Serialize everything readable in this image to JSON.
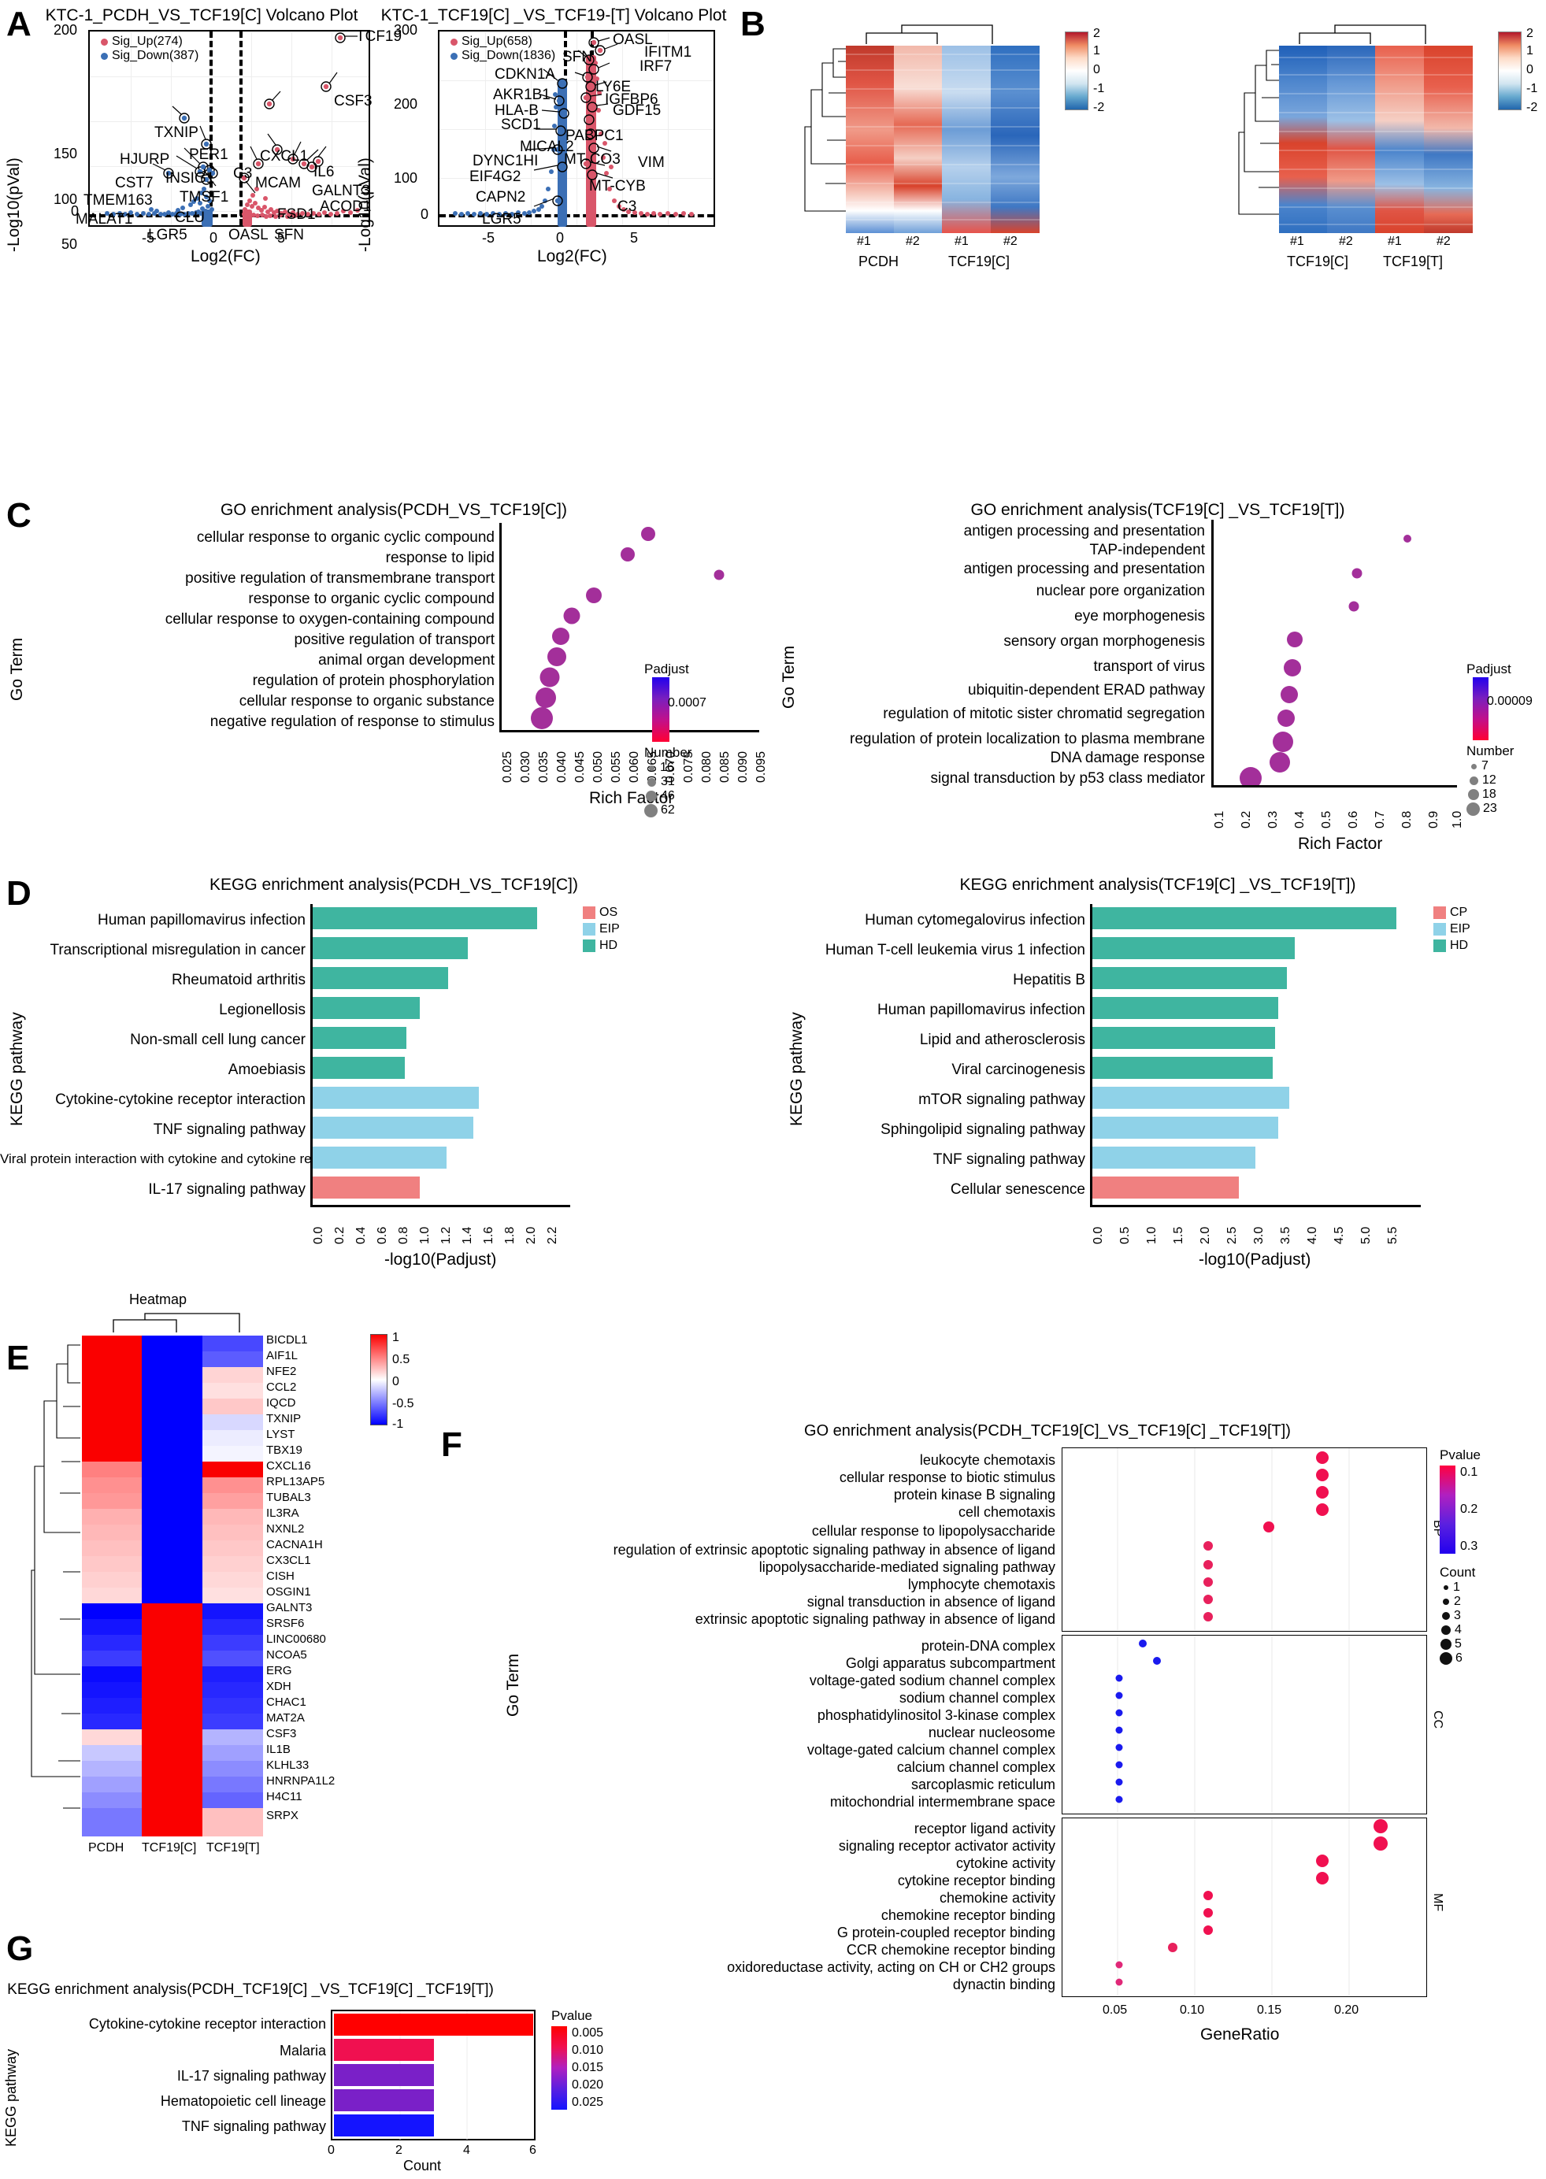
{
  "panels": {
    "A": "A",
    "B": "B",
    "C": "C",
    "D": "D",
    "E": "E",
    "F": "F",
    "G": "G"
  },
  "volcano1": {
    "title": "KTC-1_PCDH_VS_TCF19[C] Volcano Plot",
    "xlabel": "Log2(FC)",
    "ylabel": "-Log10(pVal)",
    "legend": [
      "Sig_Up(274)",
      "Sig_Down(387)"
    ],
    "up_color": "#d9566a",
    "down_color": "#3b6fb5",
    "yticks": [
      "0",
      "50",
      "100",
      "150",
      "200"
    ],
    "xticks": [
      "-5",
      "0",
      "5"
    ],
    "labels": [
      "TCF19",
      "CSF3",
      "TXNIP",
      "HJURP",
      "PER1",
      "CXCL1",
      "CST7",
      "INSIG1",
      "C3",
      "MCAM",
      "IL6",
      "TMEM163",
      "TMSF1",
      "GALNT3",
      "ACOD1",
      "MALAT1",
      "CLU",
      "FSD1",
      "LGR5",
      "OASL",
      "SFN"
    ]
  },
  "volcano2": {
    "title": "KTC-1_TCF19[C] _VS_TCF19-[T] Volcano Plot",
    "xlabel": "Log2(FC)",
    "ylabel": "-Log10(pVal)",
    "legend": [
      "Sig_Up(658)",
      "Sig_Down(1836)"
    ],
    "up_color": "#d9566a",
    "down_color": "#3b6fb5",
    "yticks": [
      "0",
      "100",
      "200",
      "300"
    ],
    "xticks": [
      "-5",
      "0",
      "5"
    ],
    "labels": [
      "OASL",
      "IFITM1",
      "SFN",
      "IRF7",
      "CDKN1A",
      "LY6E",
      "AKR1B1",
      "IGFBP6",
      "HLA-B",
      "GDF15",
      "SCD1",
      "PABPC1",
      "MICAL2",
      "DYNC1HI",
      "MT-CO3",
      "VIM",
      "EIF4G2",
      "MT-CYB",
      "CAPN2",
      "C3",
      "LGR5"
    ]
  },
  "heatmapB": {
    "left": {
      "groups": [
        "PCDH",
        "TCF19[C]"
      ],
      "columns": [
        "#1",
        "#2",
        "#1",
        "#2"
      ]
    },
    "right": {
      "groups": [
        "TCF19[C]",
        "TCF19[T]"
      ],
      "columns": [
        "#1",
        "#2",
        "#1",
        "#2"
      ]
    },
    "scale_ticks": [
      "2",
      "1",
      "0",
      "-1",
      "-2"
    ]
  },
  "goC_left": {
    "title": "GO enrichment analysis(PCDH_VS_TCF19[C])",
    "ylabel": "Go Term",
    "xlabel": "Rich Factor",
    "chart_data": {
      "type": "scatter",
      "title": "GO enrichment analysis(PCDH_VS_TCF19[C])",
      "xlabel": "Rich Factor",
      "ylabel": "Go Term",
      "categories": [
        "cellular response to organic cyclic compound",
        "response to lipid",
        "positive regulation of transmembrane transport",
        "response to organic cyclic compound",
        "cellular response to oxygen-containing compound",
        "positive regulation of transport",
        "animal organ development",
        "regulation of protein phosphorylation",
        "cellular response to organic substance",
        "negative regulation of response to stimulus"
      ],
      "rich_factor": [
        0.065,
        0.06,
        0.085,
        0.05,
        0.044,
        0.041,
        0.04,
        0.038,
        0.037,
        0.036
      ],
      "counts": [
        31,
        31,
        16,
        31,
        38,
        40,
        46,
        48,
        56,
        62
      ],
      "xticks": [
        "0.025",
        "0.030",
        "0.035",
        "0.040",
        "0.045",
        "0.050",
        "0.055",
        "0.060",
        "0.065",
        "0.070",
        "0.075",
        "0.080",
        "0.085",
        "0.090",
        "0.095"
      ],
      "xlim": [
        0.025,
        0.095
      ]
    },
    "legend": {
      "padjust_label": "Padjust",
      "padjust_value": "0.0007",
      "number_label": "Number",
      "numbers": [
        "16",
        "31",
        "46",
        "62"
      ]
    }
  },
  "goC_right": {
    "title": "GO enrichment analysis(TCF19[C] _VS_TCF19[T])",
    "ylabel": "Go Term",
    "xlabel": "Rich Factor",
    "chart_data": {
      "type": "scatter",
      "title": "GO enrichment analysis(TCF19[C] _VS_TCF19[T])",
      "xlabel": "Rich Factor",
      "ylabel": "Go Term",
      "categories": [
        "antigen processing and presentation",
        "TAP-independent",
        "antigen processing and presentation",
        "nuclear pore organization",
        "eye morphogenesis",
        "sensory organ morphogenesis",
        "transport of virus",
        "ubiquitin-dependent ERAD pathway",
        "regulation of mitotic sister chromatid segregation",
        "regulation of protein localization to plasma membrane",
        "DNA damage response",
        "signal transduction by p53 class mediator"
      ],
      "rich_factor": [
        null,
        0.8,
        0.62,
        0.6,
        0.37,
        0.36,
        0.35,
        0.34,
        0.33,
        0.31,
        0.3,
        0.28
      ],
      "counts": [
        7,
        7,
        7,
        7,
        12,
        12,
        12,
        12,
        18,
        18,
        18,
        23
      ],
      "xticks": [
        "0.1",
        "0.2",
        "0.3",
        "0.4",
        "0.5",
        "0.6",
        "0.7",
        "0.8",
        "0.9",
        "1.0"
      ],
      "xlim": [
        0.1,
        1.0
      ]
    },
    "legend": {
      "padjust_label": "Padjust",
      "padjust_value": "0.00009",
      "number_label": "Number",
      "numbers": [
        "7",
        "12",
        "18",
        "23"
      ]
    }
  },
  "keggD_left": {
    "title": "KEGG enrichment analysis(PCDH_VS_TCF19[C])",
    "ylabel": "KEGG pathway",
    "xlabel": "-log10(Padjust)",
    "legend": [
      {
        "label": "OS",
        "color": "#f08080"
      },
      {
        "label": "EIP",
        "color": "#8fd2e8"
      },
      {
        "label": "HD",
        "color": "#3fb5a0"
      }
    ],
    "chart_data": {
      "type": "bar",
      "title": "KEGG enrichment analysis(PCDH_VS_TCF19[C])",
      "xlabel": "-log10(Padjust)",
      "ylabel": "KEGG pathway",
      "categories": [
        "Human papillomavirus infection",
        "Transcriptional misregulation in cancer",
        "Rheumatoid arthritis",
        "Legionellosis",
        "Non-small cell lung cancer",
        "Amoebiasis",
        "Cytokine-cytokine receptor interaction",
        "TNF signaling pathway",
        "Viral protein interaction with cytokine and cytokine receptor",
        "IL-17 signaling pathway"
      ],
      "values": [
        2.1,
        1.45,
        1.27,
        1.0,
        0.88,
        0.86,
        1.55,
        1.5,
        1.25,
        1.0
      ],
      "groups": [
        "HD",
        "HD",
        "HD",
        "HD",
        "HD",
        "HD",
        "EIP",
        "EIP",
        "EIP",
        "OS"
      ],
      "xticks": [
        "0.0",
        "0.2",
        "0.4",
        "0.6",
        "0.8",
        "1.0",
        "1.2",
        "1.4",
        "1.6",
        "1.8",
        "2.0",
        "2.2"
      ],
      "xlim": [
        0,
        2.2
      ]
    }
  },
  "keggD_right": {
    "title": "KEGG enrichment analysis(TCF19[C] _VS_TCF19[T])",
    "ylabel": "KEGG pathway",
    "xlabel": "-log10(Padjust)",
    "legend": [
      {
        "label": "CP",
        "color": "#f08080"
      },
      {
        "label": "EIP",
        "color": "#8fd2e8"
      },
      {
        "label": "HD",
        "color": "#3fb5a0"
      }
    ],
    "chart_data": {
      "type": "bar",
      "title": "KEGG enrichment analysis(TCF19[C] _VS_TCF19[T])",
      "xlabel": "-log10(Padjust)",
      "ylabel": "KEGG pathway",
      "categories": [
        "Human cytomegalovirus infection",
        "Human T-cell leukemia virus 1 infection",
        "Hepatitis B",
        "Human papillomavirus infection",
        "Lipid and atherosclerosis",
        "Viral carcinogenesis",
        "mTOR signaling pathway",
        "Sphingolipid signaling pathway",
        "TNF signaling pathway",
        "Cellular senescence"
      ],
      "values": [
        5.4,
        3.6,
        3.45,
        3.3,
        3.25,
        3.2,
        3.5,
        3.3,
        2.9,
        2.6
      ],
      "groups": [
        "HD",
        "HD",
        "HD",
        "HD",
        "HD",
        "HD",
        "EIP",
        "EIP",
        "EIP",
        "CP"
      ],
      "xticks": [
        "0.0",
        "0.5",
        "1.0",
        "1.5",
        "2.0",
        "2.5",
        "3.0",
        "3.5",
        "4.0",
        "4.5",
        "5.0",
        "5.5"
      ],
      "xlim": [
        0,
        5.5
      ]
    }
  },
  "heatmapE": {
    "title": "Heatmap",
    "columns": [
      "PCDH",
      "TCF19[C]",
      "TCF19[T]"
    ],
    "scale_ticks": [
      "1",
      "0.5",
      "0",
      "-0.5",
      "-1"
    ],
    "genes": [
      "BICDL1",
      "AIF1L",
      "NFE2",
      "CCL2",
      "IQCD",
      "TXNIP",
      "LYST",
      "TBX19",
      "CXCL16",
      "RPL13AP5",
      "TUBAL3",
      "IL3RA",
      "NXNL2",
      "CACNA1H",
      "CX3CL1",
      "CISH",
      "OSGIN1",
      "GALNT3",
      "SRSF6",
      "LINC00680",
      "NCOA5",
      "ERG",
      "XDH",
      "CHAC1",
      "MAT2A",
      "CSF3",
      "IL1B",
      "KLHL33",
      "HNRNPA1L2",
      "H4C11",
      "SRPX"
    ]
  },
  "goF": {
    "title": "GO enrichment analysis(PCDH_TCF19[C]_VS_TCF19[C] _TCF19[T])",
    "ylabel": "Go Term",
    "xlabel": "GeneRatio",
    "facets": [
      "BP",
      "CC",
      "MF"
    ],
    "legend": {
      "pvalue_label": "Pvalue",
      "pvalue_ticks": [
        "0.1",
        "0.2",
        "0.3"
      ],
      "count_label": "Count",
      "counts": [
        "1",
        "2",
        "3",
        "4",
        "5",
        "6"
      ]
    },
    "chart_data": {
      "type": "scatter",
      "title": "GO enrichment analysis(PCDH_TCF19[C]_VS_TCF19[C] _TCF19[T])",
      "xlabel": "GeneRatio",
      "ylabel": "Go Term",
      "xticks": [
        "0.05",
        "0.10",
        "0.15",
        "0.20"
      ],
      "xlim": [
        0.03,
        0.23
      ],
      "facet_BP": {
        "categories": [
          "leukocyte chemotaxis",
          "cellular response to biotic stimulus",
          "protein kinase B signaling",
          "cell chemotaxis",
          "cellular response to lipopolysaccharide",
          "regulation of extrinsic apoptotic signaling pathway in absence of ligand",
          "lipopolysaccharide-mediated signaling pathway",
          "lymphocyte chemotaxis",
          "signal transduction in absence of ligand",
          "extrinsic apoptotic signaling pathway in absence of ligand"
        ],
        "generatio": [
          0.178,
          0.178,
          0.178,
          0.178,
          0.145,
          0.108,
          0.108,
          0.108,
          0.108,
          0.108
        ],
        "counts": [
          5,
          5,
          5,
          5,
          4,
          3,
          3,
          3,
          3,
          3
        ],
        "pvalue": [
          0.08,
          0.08,
          0.08,
          0.08,
          0.09,
          0.1,
          0.1,
          0.1,
          0.1,
          0.1
        ]
      },
      "facet_CC": {
        "categories": [
          "protein-DNA complex",
          "Golgi apparatus subcompartment",
          "voltage-gated sodium channel complex",
          "sodium channel complex",
          "phosphatidylinositol 3-kinase complex",
          "nuclear nucleosome",
          "voltage-gated calcium channel complex",
          "calcium channel complex",
          "sarcoplasmic reticulum",
          "mitochondrial intermembrane space"
        ],
        "generatio": [
          0.062,
          0.072,
          0.053,
          0.053,
          0.053,
          0.053,
          0.053,
          0.053,
          0.053,
          0.053
        ],
        "counts": [
          2,
          2,
          1,
          1,
          1,
          1,
          1,
          1,
          1,
          1
        ],
        "pvalue": [
          0.3,
          0.3,
          0.32,
          0.32,
          0.32,
          0.32,
          0.32,
          0.32,
          0.32,
          0.32
        ]
      },
      "facet_MF": {
        "categories": [
          "receptor ligand activity",
          "signaling receptor activator activity",
          "cytokine activity",
          "cytokine receptor binding",
          "chemokine activity",
          "chemokine receptor binding",
          "G protein-coupled receptor binding",
          "CCR chemokine receptor binding",
          "oxidoreductase activity, acting on CH or CH2 groups",
          "dynactin binding"
        ],
        "generatio": [
          0.215,
          0.215,
          0.178,
          0.178,
          0.108,
          0.108,
          0.108,
          0.085,
          0.053,
          0.053
        ],
        "counts": [
          6,
          6,
          5,
          5,
          3,
          3,
          3,
          3,
          1,
          1
        ],
        "pvalue": [
          0.05,
          0.05,
          0.06,
          0.06,
          0.08,
          0.08,
          0.08,
          0.09,
          0.12,
          0.12
        ]
      }
    }
  },
  "keggG": {
    "title": "KEGG enrichment analysis(PCDH_TCF19[C] _VS_TCF19[C] _TCF19[T])",
    "ylabel": "KEGG pathway",
    "xlabel": "Count",
    "legend": {
      "pvalue_label": "Pvalue",
      "ticks": [
        "0.005",
        "0.010",
        "0.015",
        "0.020",
        "0.025"
      ]
    },
    "chart_data": {
      "type": "bar",
      "title": "KEGG enrichment analysis(PCDH_TCF19[C] _VS_TCF19[C] _TCF19[T])",
      "xlabel": "Count",
      "ylabel": "KEGG pathway",
      "categories": [
        "Cytokine-cytokine receptor interaction",
        "Malaria",
        "IL-17 signaling pathway",
        "Hematopoietic cell lineage",
        "TNF signaling pathway"
      ],
      "values": [
        6,
        3,
        3,
        3,
        3
      ],
      "pvalue": [
        0.003,
        0.007,
        0.018,
        0.02,
        0.025
      ],
      "colors": [
        "#ff0000",
        "#f01050",
        "#7a20c8",
        "#7a20c8",
        "#1414ff"
      ],
      "xticks": [
        "0",
        "2",
        "4",
        "6"
      ],
      "xlim": [
        0,
        6
      ]
    }
  }
}
